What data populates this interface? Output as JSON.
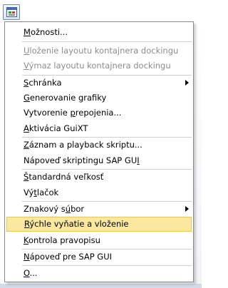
{
  "toolbar": {
    "icon": "window-menu-icon"
  },
  "menu": {
    "items": [
      {
        "label": "Možnosti...",
        "access": "M",
        "rest": "ožnosti...",
        "pre": ""
      },
      {
        "label": "Uloženie layoutu kontajnera dockingu",
        "pre": "",
        "access": "U",
        "rest": "loženie layoutu kontajnera dockingu",
        "disabled": true
      },
      {
        "label": "Výmaz layoutu kontajnera dockingu",
        "pre": "",
        "access": "V",
        "rest": "ýmaz layoutu kontajnera dockingu",
        "disabled": true
      },
      {
        "label": "Schránka",
        "pre": "",
        "access": "S",
        "rest": "chránka",
        "submenu": true
      },
      {
        "label": "Generovanie grafiky",
        "pre": "",
        "access": "G",
        "rest": "enerovanie grafiky"
      },
      {
        "label": "Vytvorenie prepojenia...",
        "pre": "Vytvorenie ",
        "access": "p",
        "rest": "repojenia..."
      },
      {
        "label": "Aktivácia GuiXT",
        "pre": "",
        "access": "A",
        "rest": "ktivácia GuiXT"
      },
      {
        "label": "Záznam a playback skriptu...",
        "pre": "",
        "access": "Z",
        "rest": "áznam a playback skriptu..."
      },
      {
        "label": "Nápoveď skriptingu SAP GUI",
        "pre": "Nápoveď skriptingu SAP GU",
        "access": "I",
        "rest": ""
      },
      {
        "label": "Štandardná veľkosť",
        "pre": "",
        "access": "Š",
        "rest": "tandardná veľkosť"
      },
      {
        "label": "Výtlačok",
        "pre": "Vý",
        "access": "t",
        "rest": "lačok"
      },
      {
        "label": "Znakový súbor",
        "pre": "Znakový s",
        "access": "ú",
        "rest": "bor",
        "submenu": true
      },
      {
        "label": "Rýchle vyňatie a vloženie",
        "pre": "",
        "access": "R",
        "rest": "ýchle vyňatie a vloženie",
        "highlighted": true
      },
      {
        "label": "Kontrola pravopisu",
        "pre": "",
        "access": "K",
        "rest": "ontrola pravopisu"
      },
      {
        "label": "Nápoveď pre SAP GUI",
        "pre": "",
        "access": "N",
        "rest": "ápoveď pre SAP GUI"
      },
      {
        "label": "O...",
        "pre": "",
        "access": "O",
        "rest": "..."
      }
    ]
  }
}
